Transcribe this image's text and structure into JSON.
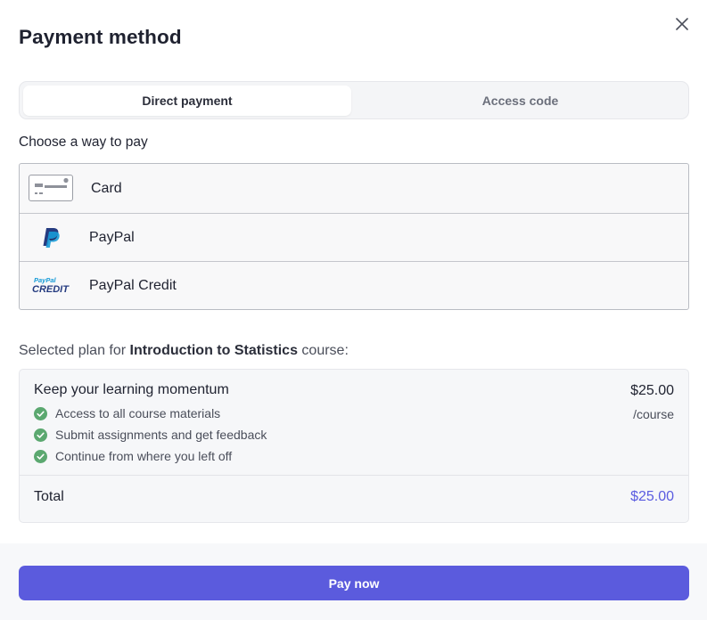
{
  "modal": {
    "title": "Payment method"
  },
  "tabs": [
    {
      "label": "Direct payment",
      "active": true
    },
    {
      "label": "Access code",
      "active": false
    }
  ],
  "payment": {
    "prompt": "Choose a way to pay",
    "methods": [
      {
        "label": "Card",
        "icon": "credit-card-icon"
      },
      {
        "label": "PayPal",
        "icon": "paypal-icon"
      },
      {
        "label": "PayPal Credit",
        "icon": "paypal-credit-icon"
      }
    ],
    "paypal_credit_logo_text": [
      "PayPal",
      "CREDIT"
    ]
  },
  "plan": {
    "label_prefix": "Selected plan for ",
    "course_name": "Introduction to Statistics",
    "label_suffix": " course:",
    "name": "Keep your learning momentum",
    "price": "$25.00",
    "per": "/course",
    "features": [
      "Access to all course materials",
      "Submit assignments and get feedback",
      "Continue from where you left off"
    ],
    "total_label": "Total",
    "total_value": "$25.00"
  },
  "footer": {
    "pay_label": "Pay now"
  },
  "colors": {
    "accent": "#5b5bdd",
    "total_text": "#5a5ce0",
    "check": "#5ba870",
    "paypal_dark": "#253b80",
    "paypal_light": "#179bd7"
  }
}
